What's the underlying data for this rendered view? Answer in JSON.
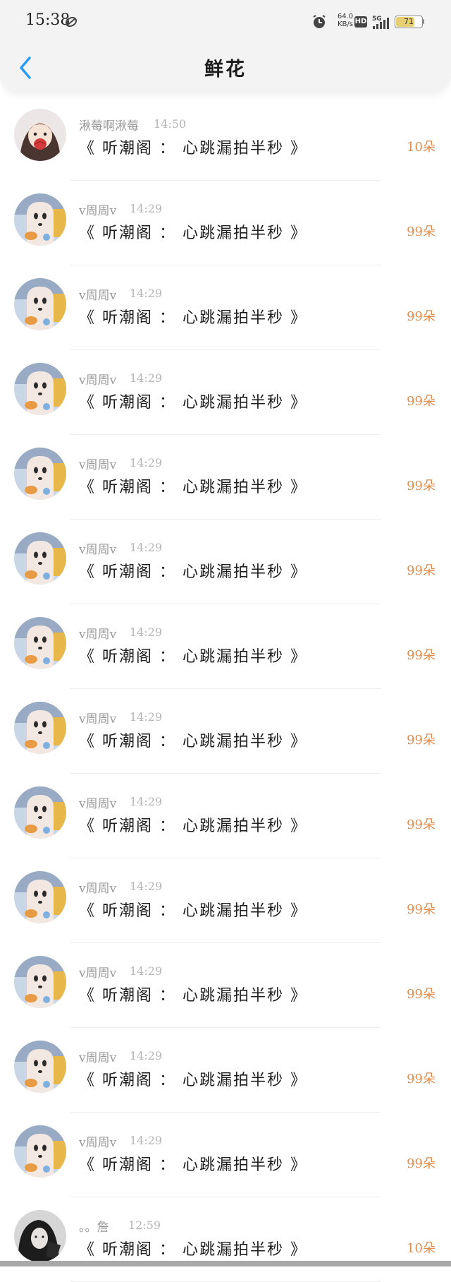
{
  "status_bar": {
    "time": "15:38",
    "speed_value": "64.0",
    "speed_unit": "KB/s",
    "hd_label": "HD",
    "network_label": "5G",
    "battery_level": "71",
    "battery_fraction": 0.71,
    "battery_color": "#e8cf73"
  },
  "header": {
    "title": "鲜花",
    "back_icon": "chevron-left-icon",
    "back_color": "#2a9bf0"
  },
  "colors": {
    "count_color": "#e08d4d",
    "name_color": "#9a9a9a",
    "time_color": "#b5b5b5"
  },
  "items": [
    {
      "name": "湫莓啊湫莓",
      "time": "14:50",
      "text": "《 听潮阁 ： 心跳漏拍半秒 》",
      "count": "10朵",
      "avatar": "girl-avatar"
    },
    {
      "name": "v周周v",
      "time": "14:29",
      "text": "《 听潮阁 ： 心跳漏拍半秒 》",
      "count": "99朵",
      "avatar": "ghost-avatar"
    },
    {
      "name": "v周周v",
      "time": "14:29",
      "text": "《 听潮阁 ： 心跳漏拍半秒 》",
      "count": "99朵",
      "avatar": "ghost-avatar"
    },
    {
      "name": "v周周v",
      "time": "14:29",
      "text": "《 听潮阁 ： 心跳漏拍半秒 》",
      "count": "99朵",
      "avatar": "ghost-avatar"
    },
    {
      "name": "v周周v",
      "time": "14:29",
      "text": "《 听潮阁 ： 心跳漏拍半秒 》",
      "count": "99朵",
      "avatar": "ghost-avatar"
    },
    {
      "name": "v周周v",
      "time": "14:29",
      "text": "《 听潮阁 ： 心跳漏拍半秒 》",
      "count": "99朵",
      "avatar": "ghost-avatar"
    },
    {
      "name": "v周周v",
      "time": "14:29",
      "text": "《 听潮阁 ： 心跳漏拍半秒 》",
      "count": "99朵",
      "avatar": "ghost-avatar"
    },
    {
      "name": "v周周v",
      "time": "14:29",
      "text": "《 听潮阁 ： 心跳漏拍半秒 》",
      "count": "99朵",
      "avatar": "ghost-avatar"
    },
    {
      "name": "v周周v",
      "time": "14:29",
      "text": "《 听潮阁 ： 心跳漏拍半秒 》",
      "count": "99朵",
      "avatar": "ghost-avatar"
    },
    {
      "name": "v周周v",
      "time": "14:29",
      "text": "《 听潮阁 ： 心跳漏拍半秒 》",
      "count": "99朵",
      "avatar": "ghost-avatar"
    },
    {
      "name": "v周周v",
      "time": "14:29",
      "text": "《 听潮阁 ： 心跳漏拍半秒 》",
      "count": "99朵",
      "avatar": "ghost-avatar"
    },
    {
      "name": "v周周v",
      "time": "14:29",
      "text": "《 听潮阁 ： 心跳漏拍半秒 》",
      "count": "99朵",
      "avatar": "ghost-avatar"
    },
    {
      "name": "v周周v",
      "time": "14:29",
      "text": "《 听潮阁 ： 心跳漏拍半秒 》",
      "count": "99朵",
      "avatar": "ghost-avatar"
    },
    {
      "name": "。。詹",
      "time": "12:59",
      "text": "《 听潮阁 ： 心跳漏拍半秒 》",
      "count": "10朵",
      "avatar": "dark-hair-avatar"
    }
  ]
}
